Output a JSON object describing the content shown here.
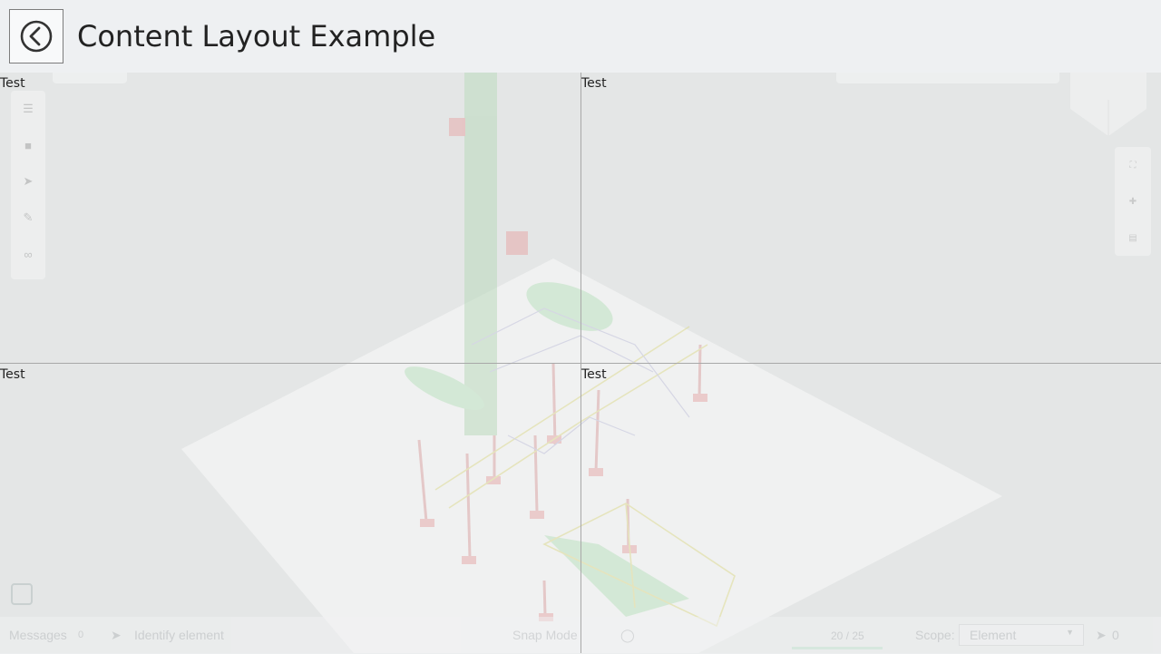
{
  "header": {
    "title": "Content Layout Example",
    "back_icon": "chevron-left-circle-icon"
  },
  "layout": {
    "cells": [
      {
        "label": "Test"
      },
      {
        "label": "Test"
      },
      {
        "label": "Test"
      },
      {
        "label": "Test"
      }
    ]
  },
  "viewer": {
    "statusbar": {
      "messages_label": "Messages",
      "messages_count": "0",
      "identify_label": "Identify element",
      "snap_mode_label": "Snap Mode",
      "progress_text": "20 / 25",
      "progress": 0.8,
      "scope_label": "Scope:",
      "scope_value": "Element",
      "selection_count": "0"
    },
    "colors": {
      "pipe_green": "#5fc06a",
      "support_red": "#c83a3a",
      "steel_yellow": "#d9d25a",
      "floor": "#ffffff"
    }
  }
}
